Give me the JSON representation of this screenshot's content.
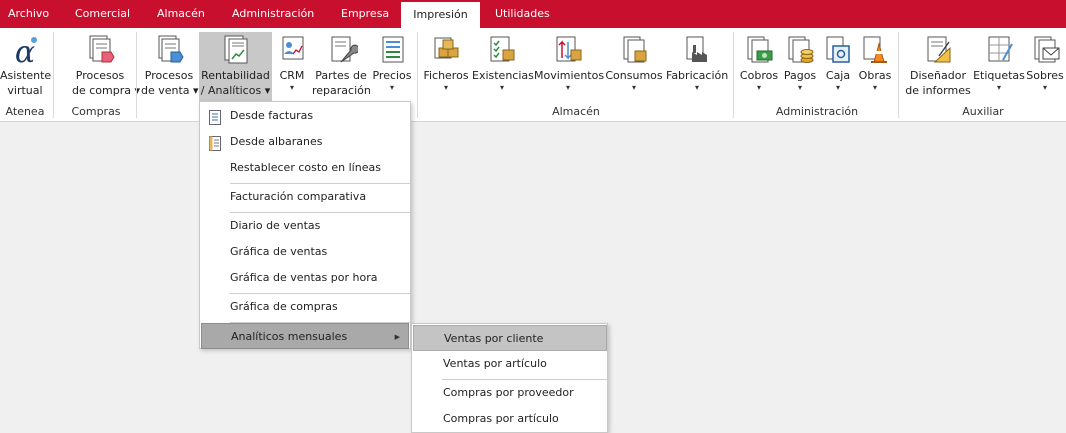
{
  "menubar": {
    "tabs": [
      "Archivo",
      "Comercial",
      "Almacén",
      "Administración",
      "Empresa",
      "Impresión",
      "Utilidades"
    ]
  },
  "ribbon": {
    "asistente": {
      "line1": "Asistente",
      "line2": "virtual",
      "icon": "alpha-icon"
    },
    "procesos_compra": {
      "line1": "Procesos",
      "line2": "de compra ▾"
    },
    "procesos_venta": {
      "line1": "Procesos",
      "line2": "de venta ▾"
    },
    "rentabilidad": {
      "line1": "Rentabilidad",
      "line2": "/ Analíticos ▾"
    },
    "crm": {
      "line1": "CRM"
    },
    "partes": {
      "line1": "Partes de",
      "line2": "reparación"
    },
    "precios": {
      "line1": "Precios"
    },
    "ficheros": {
      "line1": "Ficheros"
    },
    "existencias": {
      "line1": "Existencias"
    },
    "movimientos": {
      "line1": "Movimientos"
    },
    "consumos": {
      "line1": "Consumos"
    },
    "fabricacion": {
      "line1": "Fabricación"
    },
    "cobros": {
      "line1": "Cobros"
    },
    "pagos": {
      "line1": "Pagos"
    },
    "caja": {
      "line1": "Caja"
    },
    "obras": {
      "line1": "Obras"
    },
    "disenador": {
      "line1": "Diseñador",
      "line2": "de informes"
    },
    "etiquetas": {
      "line1": "Etiquetas"
    },
    "sobres": {
      "line1": "Sobres"
    },
    "groups": {
      "atenea": "Atenea",
      "compras": "Compras",
      "almacen": "Almacén",
      "administracion": "Administración",
      "auxiliar": "Auxiliar"
    },
    "arrow": "▾"
  },
  "dropdown": {
    "items": [
      "Desde facturas",
      "Desde albaranes",
      "Restablecer costo en líneas",
      "Facturación comparativa",
      "Diario de ventas",
      "Gráfica de ventas",
      "Gráfica de ventas por hora",
      "Gráfica de compras",
      "Analíticos mensuales"
    ],
    "submenu_arrow": "▶"
  },
  "submenu": {
    "items": [
      "Ventas por cliente",
      "Ventas por artículo",
      "Compras por proveedor",
      "Compras por artículo"
    ]
  },
  "colors": {
    "accent": "#c8102e",
    "highlight": "#a9a9a9"
  }
}
